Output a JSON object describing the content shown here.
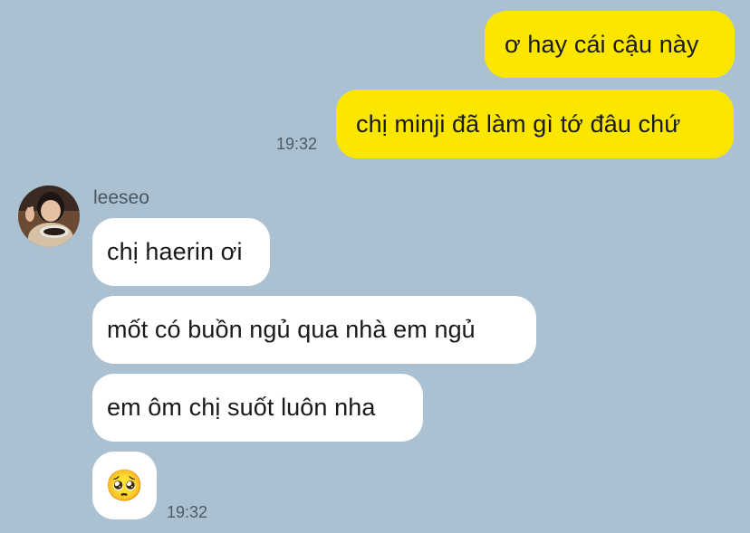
{
  "outgoing": {
    "messages": [
      {
        "text": "ơ hay cái cậu này"
      },
      {
        "text": "chị minji đã làm gì tớ đâu chứ"
      }
    ],
    "time": "19:32"
  },
  "incoming": {
    "sender_name": "leeseo",
    "messages": [
      {
        "text": "chị haerin ơi"
      },
      {
        "text": "mốt có buồn ngủ qua nhà em ngủ"
      },
      {
        "text": "em ôm chị suốt luôn nha"
      },
      {
        "text": "🥺"
      }
    ],
    "time": "19:32"
  },
  "colors": {
    "background": "#abc1d1",
    "outgoing_bubble": "#fbe600",
    "incoming_bubble": "#ffffff"
  }
}
